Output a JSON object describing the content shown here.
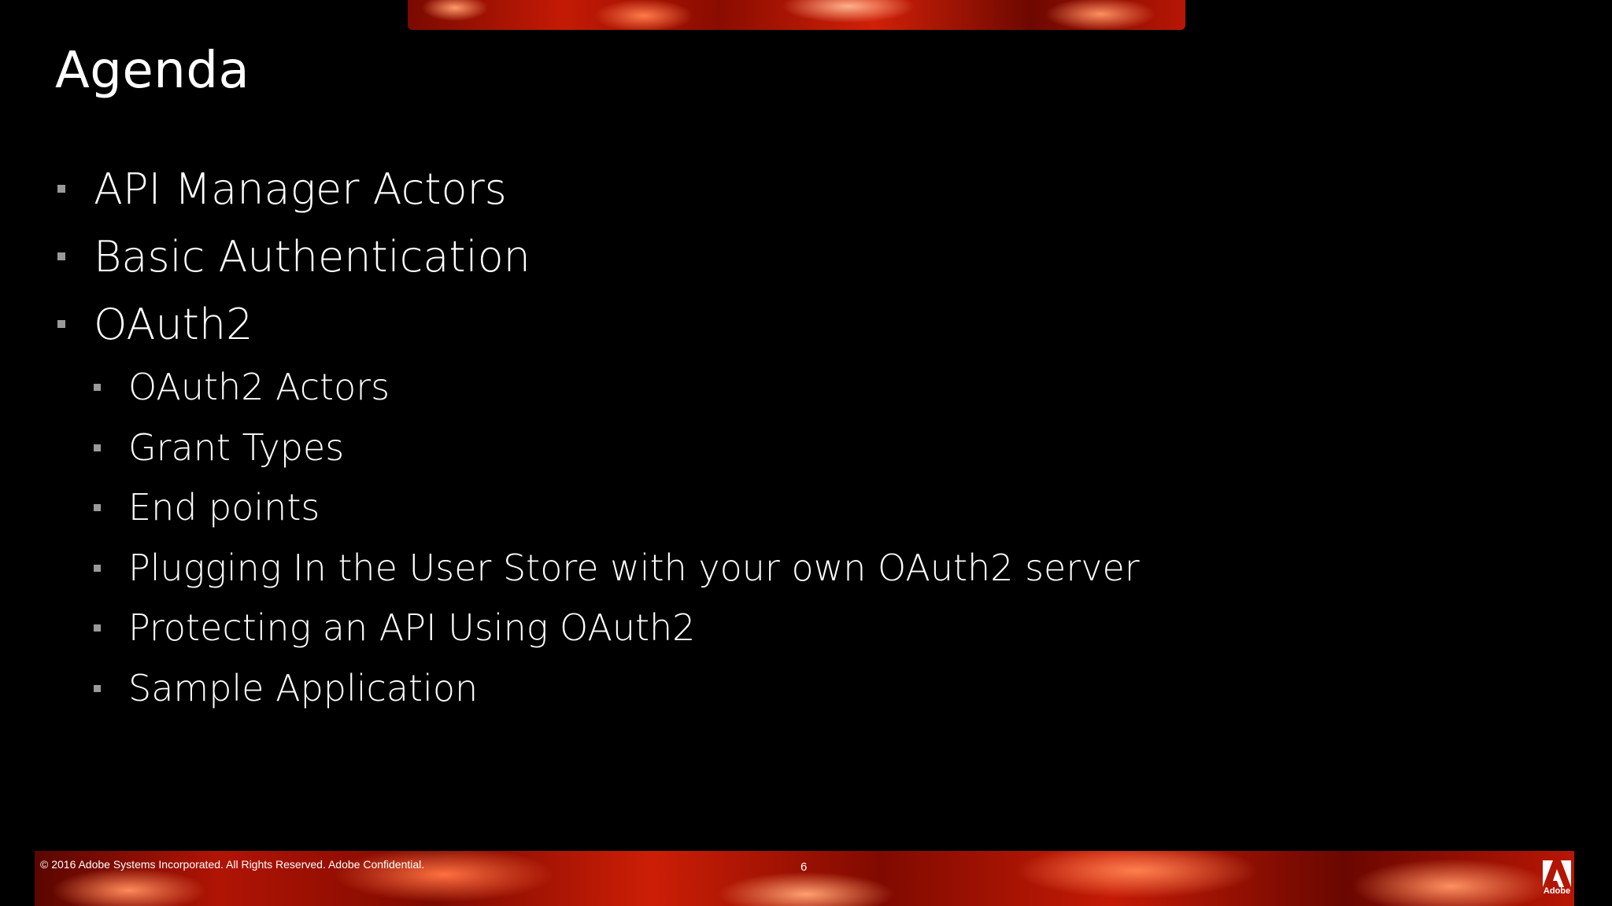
{
  "slide": {
    "title": "Agenda",
    "bullets": [
      {
        "level": 1,
        "text": "API Manager Actors"
      },
      {
        "level": 1,
        "text": "Basic Authentication"
      },
      {
        "level": 1,
        "text": "OAuth2"
      },
      {
        "level": 2,
        "text": "OAuth2 Actors"
      },
      {
        "level": 2,
        "text": "Grant Types"
      },
      {
        "level": 2,
        "text": "End points"
      },
      {
        "level": 2,
        "text": "Plugging In the User Store with  your own OAuth2 server"
      },
      {
        "level": 2,
        "text": "Protecting an API Using OAuth2"
      },
      {
        "level": 2,
        "text": "Sample Application"
      }
    ]
  },
  "footer": {
    "copyright": "© 2016 Adobe Systems Incorporated.  All Rights Reserved.  Adobe Confidential.",
    "page_number": "6",
    "logo_label": "Adobe",
    "logo_icon": "adobe-logo-icon"
  },
  "colors": {
    "background": "#000000",
    "text": "#ffffff",
    "bullet_marker": "#9a9a9a",
    "accent_red": "#c41a05"
  }
}
